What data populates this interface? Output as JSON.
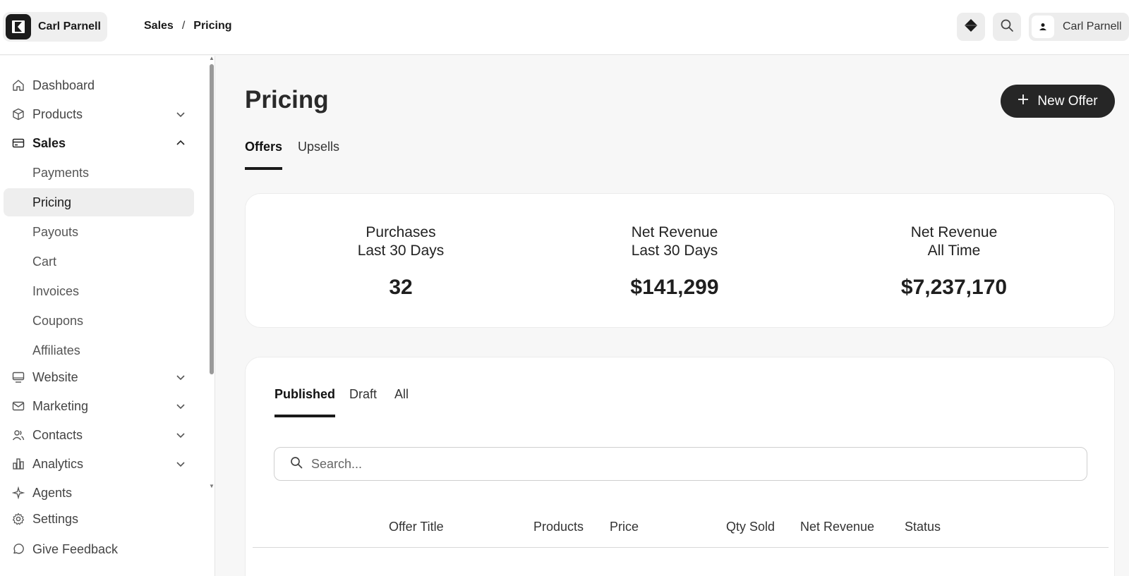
{
  "account": {
    "name": "Carl Parnell"
  },
  "breadcrumb": {
    "section": "Sales",
    "separator": "/",
    "page": "Pricing"
  },
  "user": {
    "name": "Carl Parnell"
  },
  "sidebar": {
    "items": [
      {
        "label": "Dashboard",
        "icon": "home-icon"
      },
      {
        "label": "Products",
        "icon": "box-icon",
        "expanded": false
      },
      {
        "label": "Sales",
        "icon": "credit-card-icon",
        "expanded": true
      },
      {
        "label": "Website",
        "icon": "monitor-icon",
        "expanded": false
      },
      {
        "label": "Marketing",
        "icon": "mail-icon",
        "expanded": false
      },
      {
        "label": "Contacts",
        "icon": "users-icon",
        "expanded": false
      },
      {
        "label": "Analytics",
        "icon": "bar-chart-icon",
        "expanded": false
      },
      {
        "label": "Agents",
        "icon": "sparkle-icon"
      }
    ],
    "sales_sub": [
      "Payments",
      "Pricing",
      "Payouts",
      "Cart",
      "Invoices",
      "Coupons",
      "Affiliates"
    ],
    "active_sub": "Pricing",
    "footer": [
      {
        "label": "Settings",
        "icon": "gear-icon"
      },
      {
        "label": "Give Feedback",
        "icon": "chat-icon"
      }
    ]
  },
  "main": {
    "title": "Pricing",
    "new_offer_label": "New Offer",
    "tabs": [
      "Offers",
      "Upsells"
    ],
    "active_tab": "Offers",
    "stats": [
      {
        "label_line1": "Purchases",
        "label_line2": "Last 30 Days",
        "value": "32"
      },
      {
        "label_line1": "Net Revenue",
        "label_line2": "Last 30 Days",
        "value": "$141,299"
      },
      {
        "label_line1": "Net Revenue",
        "label_line2": "All Time",
        "value": "$7,237,170"
      }
    ],
    "offer_tabs": [
      "Published",
      "Draft",
      "All"
    ],
    "active_offer_tab": "Published",
    "search_placeholder": "Search...",
    "table_headers": [
      "Offer Title",
      "Products",
      "Price",
      "Qty Sold",
      "Net Revenue",
      "Status"
    ]
  },
  "colors": {
    "accent": "#1a1a1a",
    "button_dark": "#262626",
    "background": "#f7f7f7"
  }
}
